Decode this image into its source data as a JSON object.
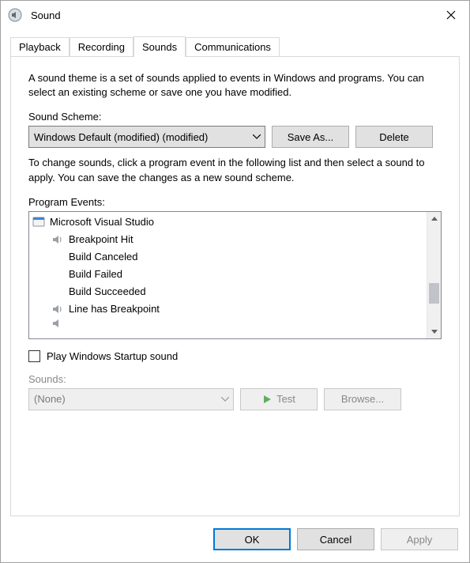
{
  "window": {
    "title": "Sound"
  },
  "tabs": {
    "t0": "Playback",
    "t1": "Recording",
    "t2": "Sounds",
    "t3": "Communications",
    "active": 2
  },
  "sounds_tab": {
    "description": "A sound theme is a set of sounds applied to events in Windows and programs.  You can select an existing scheme or save one you have modified.",
    "scheme_label": "Sound Scheme:",
    "scheme_value": "Windows Default (modified) (modified)",
    "save_as": "Save As...",
    "delete": "Delete",
    "change_desc": "To change sounds, click a program event in the following list and then select a sound to apply.  You can save the changes as a new sound scheme.",
    "events_label": "Program Events:",
    "events": {
      "group": "Microsoft Visual Studio",
      "e0": "Breakpoint Hit",
      "e1": "Build Canceled",
      "e2": "Build Failed",
      "e3": "Build Succeeded",
      "e4": "Line has Breakpoint"
    },
    "startup_checkbox": "Play Windows Startup sound",
    "startup_checked": false,
    "sounds_label": "Sounds:",
    "sound_value": "(None)",
    "test": "Test",
    "browse": "Browse..."
  },
  "footer": {
    "ok": "OK",
    "cancel": "Cancel",
    "apply": "Apply"
  },
  "colors": {
    "accent": "#0078d7"
  }
}
